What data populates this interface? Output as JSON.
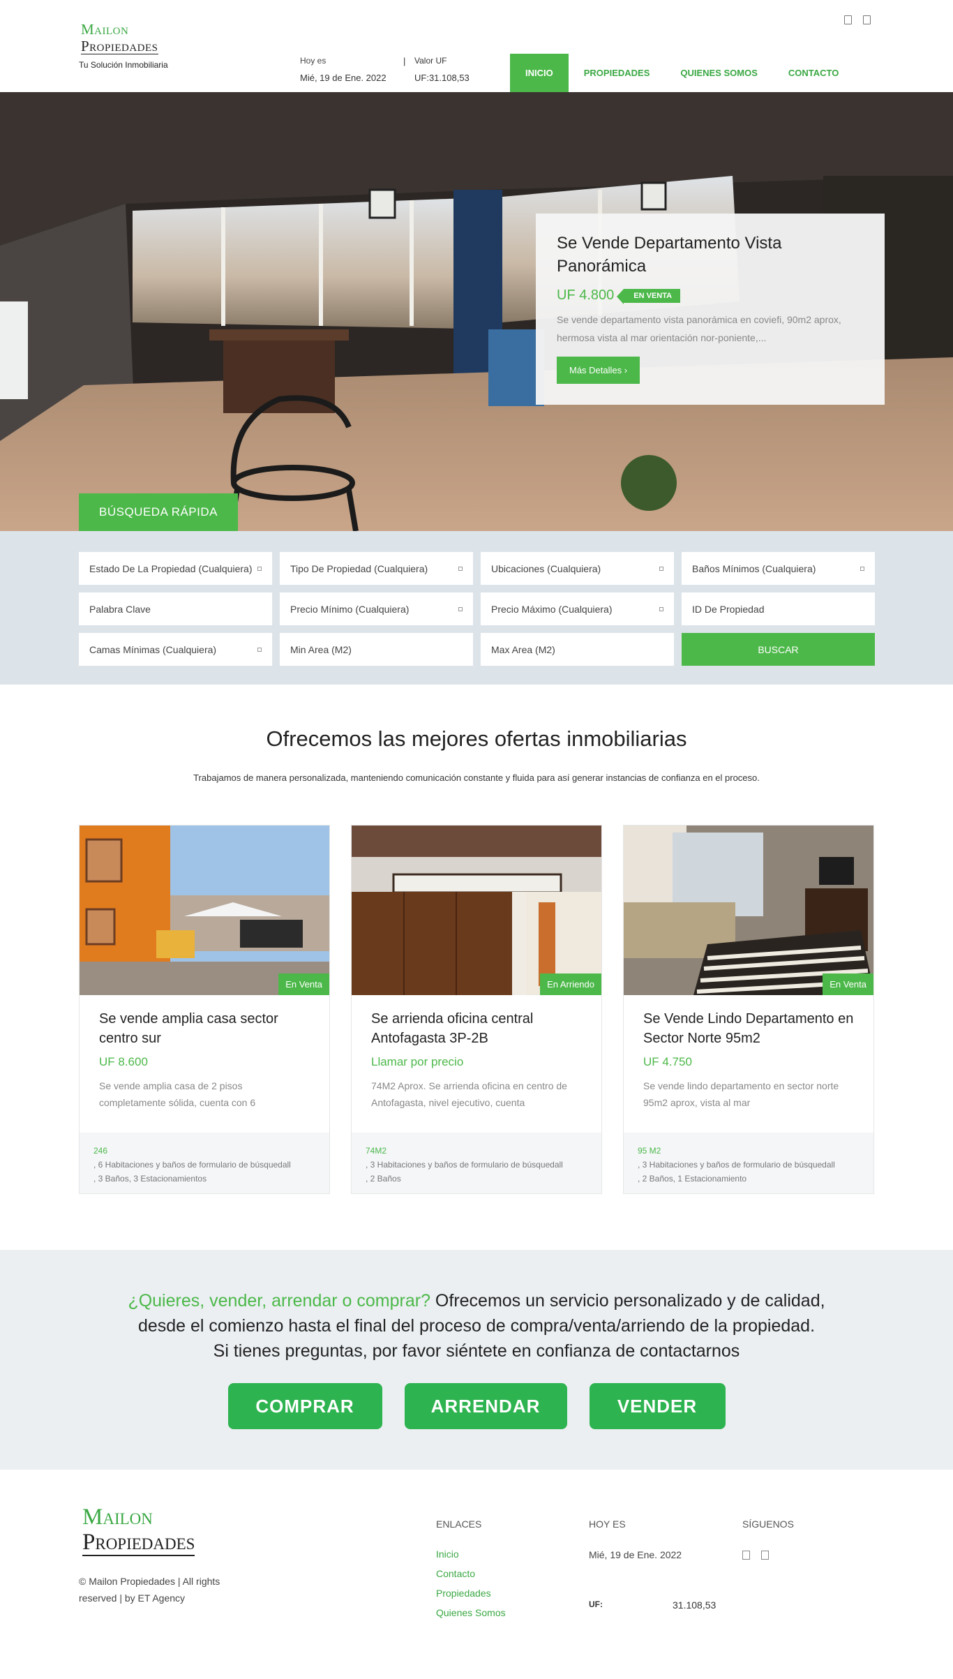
{
  "header": {
    "logo_line1": "Mailon",
    "logo_line2": "Propiedades",
    "tagline": "Tu Solución Inmobiliaria",
    "date_label": "Hoy es",
    "date_value": "Mié, 19 de Ene. 2022",
    "uf_label": "Valor UF",
    "uf_value": "UF:31.108,53",
    "separator": "|",
    "social_icons": [
      "facebook-icon",
      "instagram-icon"
    ],
    "nav": [
      {
        "label": "INICIO",
        "active": true
      },
      {
        "label": "PROPIEDADES",
        "active": false
      },
      {
        "label": "QUIENES SOMOS",
        "active": false
      },
      {
        "label": "CONTACTO",
        "active": false
      }
    ]
  },
  "hero": {
    "title": "Se Vende Departamento Vista Panorámica",
    "price": "UF 4.800",
    "status": "EN VENTA",
    "description": "Se vende departamento vista panorámica en coviefi, 90m2 aprox, hermosa vista al mar orientación nor-poniente,...",
    "button": "Más Detalles",
    "search_tab": "BÚSQUEDA RÁPIDA"
  },
  "search": {
    "fields": [
      {
        "label": "Estado De La Propiedad (Cualquiera)",
        "dropdown": true
      },
      {
        "label": "Tipo De Propiedad (Cualquiera)",
        "dropdown": true
      },
      {
        "label": "Ubicaciones (Cualquiera)",
        "dropdown": true
      },
      {
        "label": "Baños Mínimos (Cualquiera)",
        "dropdown": true
      },
      {
        "label": "Palabra Clave",
        "dropdown": false
      },
      {
        "label": "Precio Mínimo (Cualquiera)",
        "dropdown": true
      },
      {
        "label": "Precio Máximo (Cualquiera)",
        "dropdown": true
      },
      {
        "label": "ID De Propiedad",
        "dropdown": false
      },
      {
        "label": "Camas Mínimas (Cualquiera)",
        "dropdown": true
      },
      {
        "label": "Min Area (M2)",
        "dropdown": false
      },
      {
        "label": "Max Area (M2)",
        "dropdown": false
      }
    ],
    "button": "BUSCAR"
  },
  "offers": {
    "heading": "Ofrecemos las mejores ofertas inmobiliarias",
    "subheading": "Trabajamos de manera personalizada, manteniendo comunicación constante y fluida para así generar instancias de confianza en el proceso.",
    "cards": [
      {
        "status": "En Venta",
        "title": "Se vende amplia casa sector centro sur",
        "price": "UF 8.600",
        "description": "Se vende amplia casa de 2 pisos completamente sólida, cuenta con 6",
        "area": "246",
        "meta1": ",   6 Habitaciones y baños de formulario de búsquedall",
        "meta2": ",   3 Baños,   3 Estacionamientos"
      },
      {
        "status": "En Arriendo",
        "title": "Se arrienda oficina central Antofagasta 3P-2B",
        "price": "Llamar por precio",
        "description": "74M2 Aprox. Se arrienda oficina en centro de Antofagasta, nivel ejecutivo, cuenta",
        "area": "74M2",
        "meta1": ",   3 Habitaciones y baños de formulario de búsquedall",
        "meta2": ",   2 Baños"
      },
      {
        "status": "En Venta",
        "title": "Se Vende Lindo Departamento en Sector Norte 95m2",
        "price": "UF 4.750",
        "description": "Se vende lindo departamento en sector norte 95m2 aprox, vista al mar",
        "area": "95 M2",
        "meta1": ",   3 Habitaciones y baños de formulario de búsquedall",
        "meta2": ",   2 Baños,   1 Estacionamiento"
      }
    ]
  },
  "cta": {
    "highlight": "¿Quieres, vender, arrendar o comprar?",
    "line1_rest": " Ofrecemos un servicio personalizado y de calidad,",
    "line2": "desde el comienzo hasta el final del proceso de compra/venta/arriendo de la propiedad.",
    "line3": "Si tienes preguntas, por favor siéntete en confianza de contactarnos",
    "buttons": [
      "COMPRAR",
      "ARRENDAR",
      "VENDER"
    ]
  },
  "footer": {
    "logo_line1": "Mailon",
    "logo_line2": "Propiedades",
    "copyright": "© Mailon Propiedades | All rights reserved | by ET Agency",
    "links_heading": "ENLACES",
    "links": [
      "Inicio",
      "Contacto",
      "Propiedades",
      "Quienes Somos"
    ],
    "today_heading": "HOY ES",
    "today_value": "Mié, 19 de Ene. 2022",
    "uf_key": "UF:",
    "uf_value": "31.108,53",
    "follow_heading": "SÍGUENOS",
    "social_icons": [
      "facebook-icon",
      "instagram-icon"
    ]
  },
  "colors": {
    "accent": "#4cb849",
    "cta_button": "#2db34f",
    "search_bg": "#dde4e9",
    "cta_bg": "#ebeff2"
  }
}
